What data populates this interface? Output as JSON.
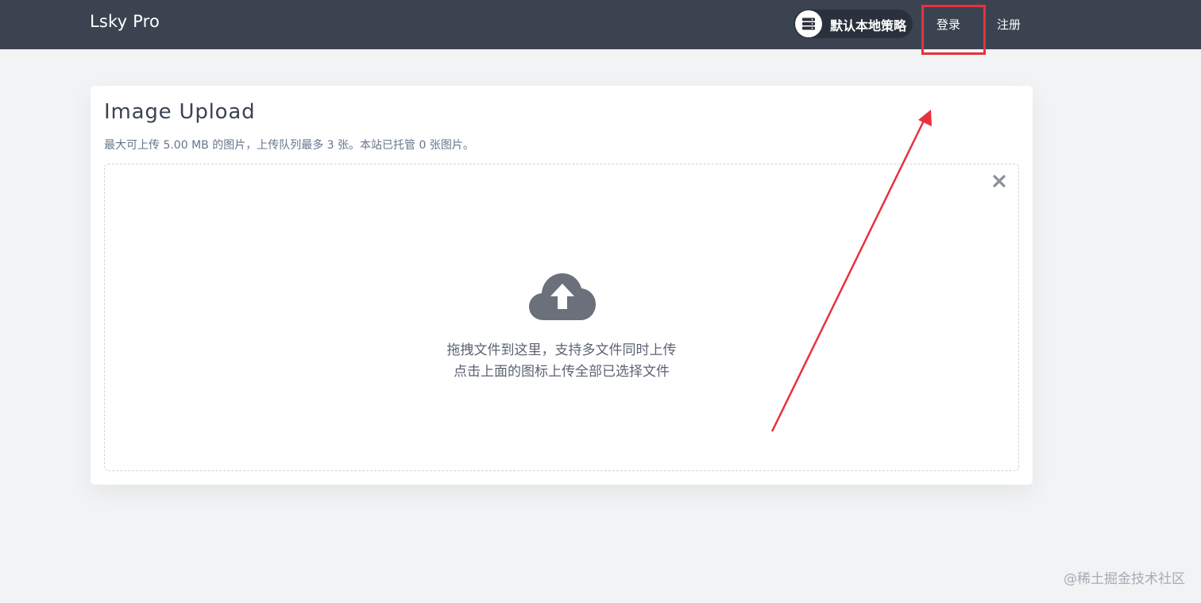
{
  "navbar": {
    "brand": "Lsky Pro",
    "strategy_label": "默认本地策略",
    "strategy_icon": "server-icon",
    "login_label": "登录",
    "register_label": "注册"
  },
  "upload": {
    "title": "Image Upload",
    "subtitle": "最大可上传 5.00 MB 的图片，上传队列最多 3 张。本站已托管 0 张图片。",
    "drop_line_1": "拖拽文件到这里，支持多文件同时上传",
    "drop_line_2": "点击上面的图标上传全部已选择文件",
    "upload_icon": "cloud-upload-icon",
    "clear_icon": "close-icon"
  },
  "watermark": "@稀土掘金技术社区",
  "colors": {
    "navbar_bg": "#3b4351",
    "page_bg": "#f1f3f5",
    "annotation": "#e8313d",
    "icon_gray": "#6b707a"
  }
}
